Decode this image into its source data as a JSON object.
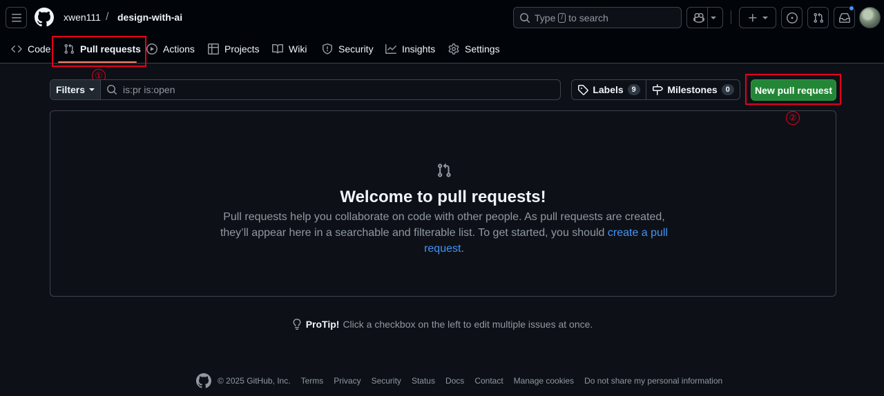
{
  "header": {
    "owner": "xwen111",
    "separator": "/",
    "repo": "design-with-ai",
    "search": {
      "prefix": "Type",
      "key": "/",
      "suffix": "to search"
    }
  },
  "tabs": [
    {
      "label": "Code",
      "icon": "code-icon"
    },
    {
      "label": "Pull requests",
      "icon": "git-pull-request-icon",
      "selected": true
    },
    {
      "label": "Actions",
      "icon": "play-icon"
    },
    {
      "label": "Projects",
      "icon": "table-icon"
    },
    {
      "label": "Wiki",
      "icon": "book-icon"
    },
    {
      "label": "Security",
      "icon": "shield-icon"
    },
    {
      "label": "Insights",
      "icon": "graph-icon"
    },
    {
      "label": "Settings",
      "icon": "gear-icon"
    }
  ],
  "annotations": {
    "first": "①",
    "second": "②",
    "color": "#e5001f"
  },
  "subnav": {
    "filters_label": "Filters",
    "filter_query": "is:pr is:open",
    "labels": {
      "label": "Labels",
      "count": "9"
    },
    "milestones": {
      "label": "Milestones",
      "count": "0"
    },
    "new_pr_label": "New pull request"
  },
  "blankslate": {
    "title": "Welcome to pull requests!",
    "description": "Pull requests help you collaborate on code with other people. As pull requests are created, they’ll appear here in a searchable and filterable list. To get started, you should ",
    "link": "create a pull request",
    "end": "."
  },
  "protip": {
    "label": "ProTip!",
    "text": "Click a checkbox on the left to edit multiple issues at once."
  },
  "footer": {
    "copyright": "© 2025 GitHub, Inc.",
    "links": [
      "Terms",
      "Privacy",
      "Security",
      "Status",
      "Docs",
      "Contact",
      "Manage cookies",
      "Do not share my personal information"
    ]
  },
  "colors": {
    "background": "#0d1117",
    "header_background": "#010409",
    "primary_button": "#238636",
    "link": "#4493f8",
    "tab_underline": "#f78166"
  }
}
